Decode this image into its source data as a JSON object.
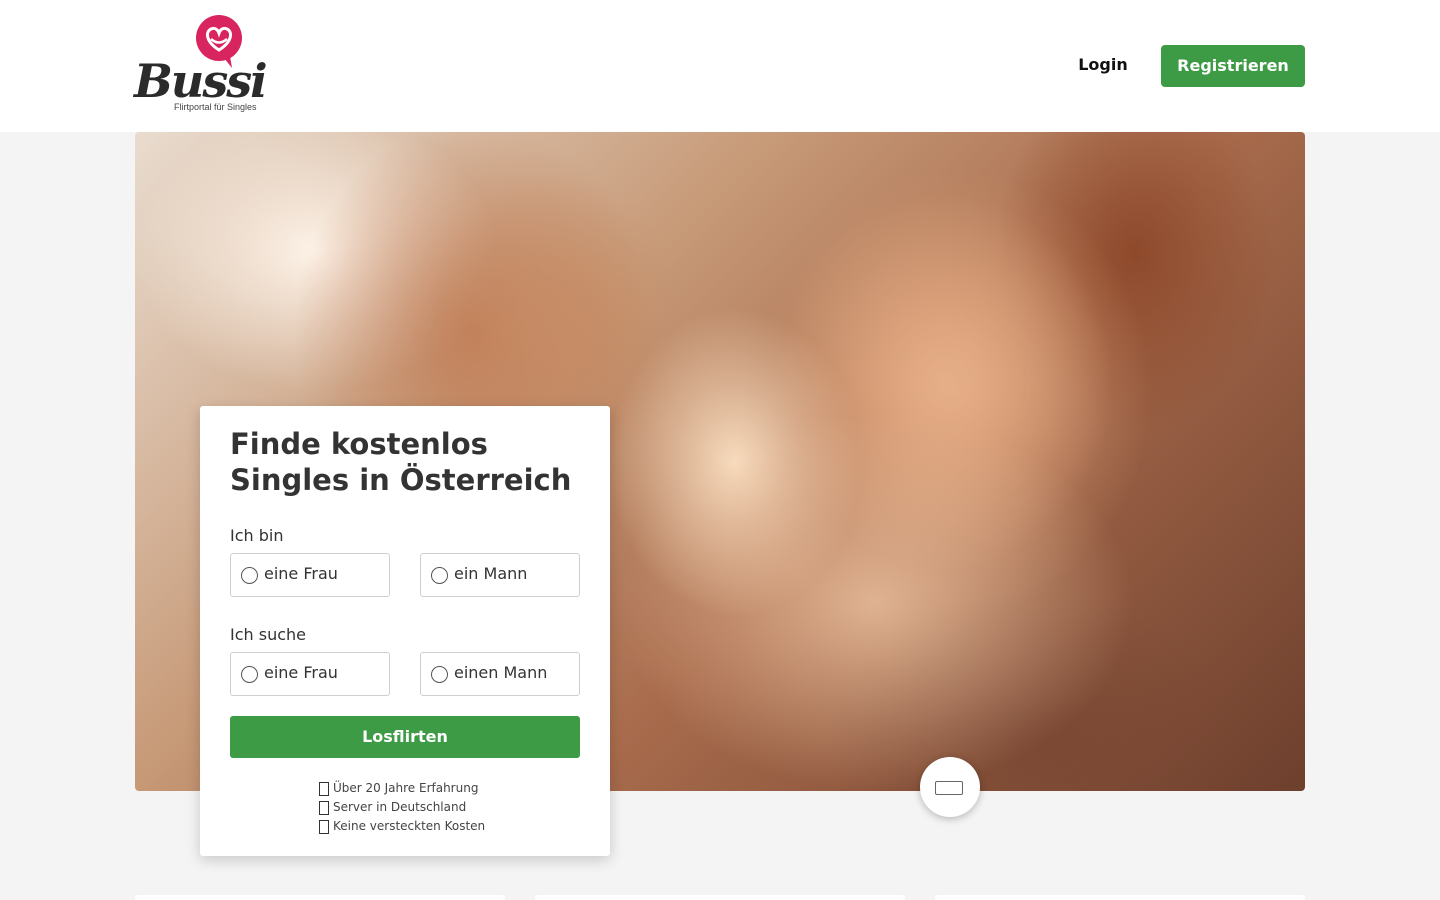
{
  "header": {
    "logo": {
      "wordmark": "Bussi",
      "tagline": "Flirtportal für Singles"
    },
    "login_label": "Login",
    "register_label": "Registrieren"
  },
  "colors": {
    "accent_green": "#3e9b45",
    "logo_pink": "#d8245f",
    "text_dark": "#333333"
  },
  "signup_card": {
    "title_line1": "Finde kostenlos",
    "title_line2": "Singles in Österreich",
    "iam": {
      "label": "Ich bin",
      "options": [
        "eine Frau",
        "ein Mann"
      ]
    },
    "seeking": {
      "label": "Ich suche",
      "options": [
        "eine Frau",
        "einen Mann"
      ]
    },
    "submit_label": "Losflirten",
    "features": [
      "Über 20 Jahre Erfahrung",
      "Server in Deutschland",
      "Keine versteckten Kosten"
    ]
  },
  "hero": {
    "image": "couple making heart shape with hands"
  },
  "icons": {
    "carousel": "slide-icon",
    "logo_heart": "heart-bubble-icon",
    "feature": "check-box-icon"
  }
}
